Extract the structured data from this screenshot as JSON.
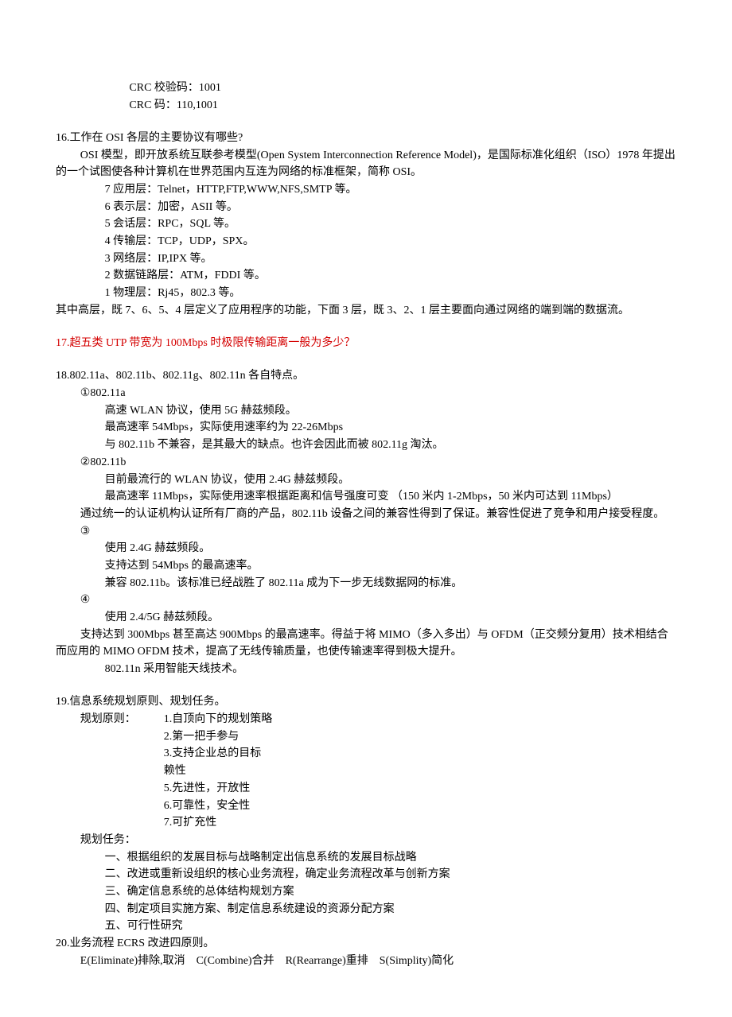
{
  "crc": {
    "line1": "CRC 校验码：1001",
    "line2": "CRC 码：110,1001"
  },
  "q16": {
    "title": "16.工作在 OSI 各层的主要协议有哪些?",
    "intro": "OSI 模型，即开放系统互联参考模型(Open System Interconnection Reference Model)，是国际标准化组织（ISO）1978 年提出的一个试图使各种计算机在世界范围内互连为网络的标准框架，简称 OSI。",
    "layers": [
      "7 应用层：Telnet，HTTP,FTP,WWW,NFS,SMTP 等。",
      "6 表示层：加密，ASII 等。",
      "5 会话层：RPC，SQL 等。",
      "4 传输层：TCP，UDP，SPX。",
      "3 网络层：IP,IPX 等。",
      "2 数据链路层：ATM，FDDI 等。",
      "1 物理层：Rj45，802.3 等。"
    ],
    "tail": "其中高层，既 7、6、5、4 层定义了应用程序的功能，下面 3 层，既 3、2、1 层主要面向通过网络的端到端的数据流。"
  },
  "q17": "17.超五类 UTP 带宽为 100Mbps 时极限传输距离一般为多少？",
  "q18": {
    "title": "18.802.11a、802.11b、802.11g、802.11n 各自特点。",
    "a_head": "①802.11a",
    "a1": "高速 WLAN 协议，使用 5G 赫兹频段。",
    "a2": "最高速率 54Mbps，实际使用速率约为 22-26Mbps",
    "a3": "与 802.11b 不兼容，是其最大的缺点。也许会因此而被 802.11g 淘汰。",
    "b_head": "②802.11b",
    "b1": "目前最流行的 WLAN 协议，使用 2.4G 赫兹频段。",
    "b2": "最高速率 11Mbps，实际使用速率根据距离和信号强度可变 （150 米内 1-2Mbps，50 米内可达到 11Mbps）",
    "b3": "通过统一的认证机构认证所有厂商的产品，802.11b 设备之间的兼容性得到了保证。兼容性促进了竞争和用户接受程度。",
    "c_head": "③",
    "c1": "使用 2.4G 赫兹频段。",
    "c2": "支持达到 54Mbps 的最高速率。",
    "c3": "兼容 802.11b。该标准已经战胜了 802.11a 成为下一步无线数据网的标准。",
    "d_head": "④",
    "d1": "使用 2.4/5G 赫兹频段。",
    "d2": "支持达到 300Mbps 甚至高达 900Mbps 的最高速率。得益于将 MIMO（多入多出）与 OFDM（正交频分复用）技术相结合而应用的 MIMO OFDM 技术，提高了无线传输质量，也使传输速率得到极大提升。",
    "d3": "802.11n 采用智能天线技术。"
  },
  "q19": {
    "title": "19.信息系统规划原则、规划任务。",
    "principles_label": "规划原则：",
    "principles": [
      "1.自顶向下的规划策略",
      "2.第一把手参与",
      "3.支持企业总的目标",
      "赖性",
      "5.先进性，开放性",
      " 6.可靠性，安全性",
      " 7.可扩充性"
    ],
    "tasks_label": "规划任务：",
    "tasks": [
      "一、根据组织的发展目标与战略制定出信息系统的发展目标战略",
      "二、改进或重新设组织的核心业务流程，确定业务流程改革与创新方案",
      "三、确定信息系统的总体结构规划方案",
      "四、制定项目实施方案、制定信息系统建设的资源分配方案",
      "五、可行性研究"
    ]
  },
  "q20": {
    "title": "20.业务流程 ECRS 改进四原则。",
    "body": "E(Eliminate)排除,取消    C(Combine)合并    R(Rearrange)重排    S(Simplity)简化"
  }
}
